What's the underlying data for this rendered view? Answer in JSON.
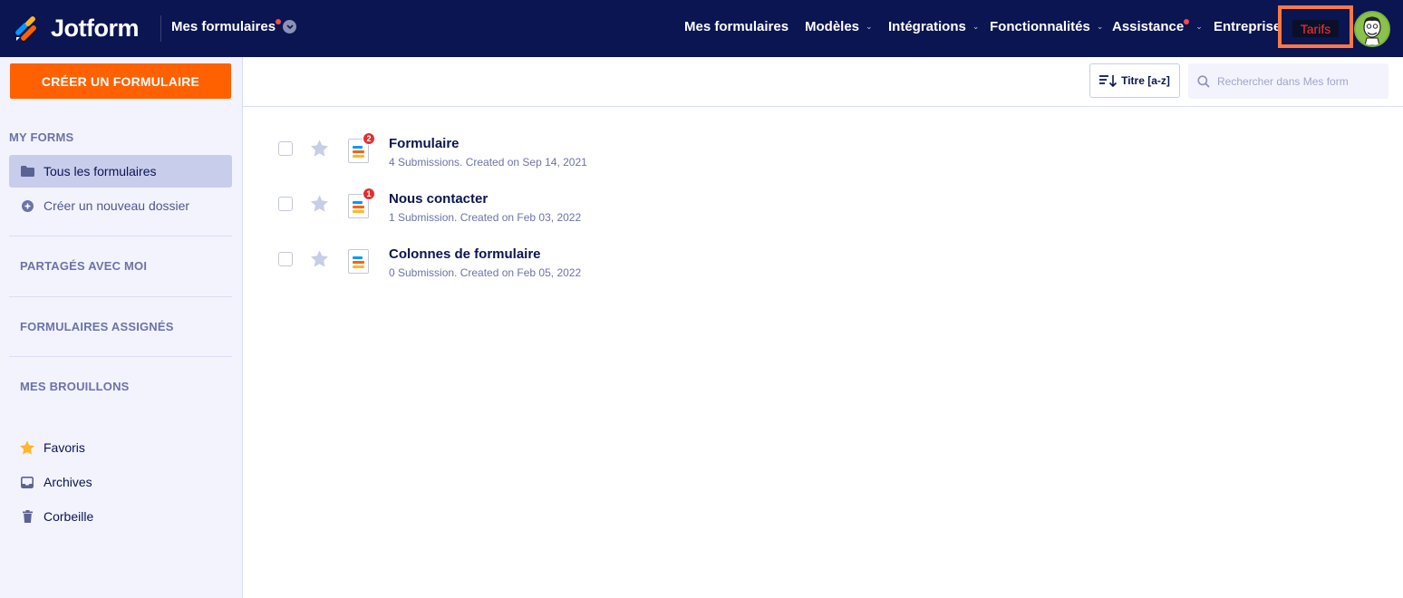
{
  "brand": {
    "name": "Jotform"
  },
  "topbar": {
    "switcher_label": "Mes formulaires",
    "nav": [
      {
        "label": "Mes formulaires",
        "has_chevron": false,
        "has_dot": false
      },
      {
        "label": "Modèles",
        "has_chevron": true,
        "has_dot": false
      },
      {
        "label": "Intégrations",
        "has_chevron": true,
        "has_dot": false
      },
      {
        "label": "Fonctionnalités",
        "has_chevron": true,
        "has_dot": false
      },
      {
        "label": "Assistance",
        "has_chevron": true,
        "has_dot": true
      },
      {
        "label": "Entreprise",
        "has_chevron": false,
        "has_dot": false
      }
    ],
    "pricing_label": "Tarifs",
    "chevron_glyph": "⌄"
  },
  "sidebar": {
    "create_button": "CRÉER UN FORMULAIRE",
    "my_forms_header": "MY FORMS",
    "all_forms": "Tous les formulaires",
    "new_folder": "Créer un nouveau dossier",
    "shared_with_me": "PARTAGÉS AVEC MOI",
    "assigned_forms": "FORMULAIRES ASSIGNÉS",
    "drafts": "MES BROUILLONS",
    "favorites": "Favoris",
    "archives": "Archives",
    "trash": "Corbeille"
  },
  "toolbar": {
    "sort_label": "Titre [a-z]",
    "search_placeholder": "Rechercher dans Mes form"
  },
  "forms": [
    {
      "title": "Formulaire",
      "meta": "4 Submissions. Created on Sep 14, 2021",
      "badge": "2"
    },
    {
      "title": "Nous contacter",
      "meta": "1 Submission. Created on Feb 03, 2022",
      "badge": "1"
    },
    {
      "title": "Colonnes de formulaire",
      "meta": "0 Submission. Created on Feb 05, 2022",
      "badge": ""
    }
  ],
  "colors": {
    "nav_bg": "#0a1551",
    "accent_orange": "#ff6100",
    "sidebar_bg": "#f3f3fe",
    "active_item_bg": "#c8cdec",
    "highlight_border": "#ff7844",
    "badge_red": "#e03131"
  }
}
